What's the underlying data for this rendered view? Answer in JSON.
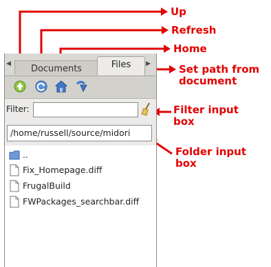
{
  "tabs": [
    {
      "label": "Documents",
      "active": false
    },
    {
      "label": "Files",
      "active": true
    }
  ],
  "toolbar": {
    "buttons": [
      {
        "name": "up-button",
        "icon": "arrow-up-icon"
      },
      {
        "name": "refresh-button",
        "icon": "refresh-icon"
      },
      {
        "name": "home-button",
        "icon": "home-icon"
      },
      {
        "name": "set-path-button",
        "icon": "set-path-icon"
      }
    ]
  },
  "filter": {
    "label": "Filter:",
    "value": "",
    "clear_icon": "broom-icon"
  },
  "folder": {
    "value": "/home/russell/source/midori"
  },
  "files": [
    {
      "name": "..",
      "type": "folder"
    },
    {
      "name": "Fix_Homepage.diff",
      "type": "file"
    },
    {
      "name": "FrugalBuild",
      "type": "file"
    },
    {
      "name": "FWPackages_searchbar.diff",
      "type": "file"
    }
  ],
  "annotations": {
    "up": "Up",
    "refresh": "Refresh",
    "home": "Home",
    "set_path_1": "Set path from",
    "set_path_2": "document",
    "filter_1": "Filter input",
    "filter_2": "box",
    "folder_1": "Folder input",
    "folder_2": "box"
  },
  "colors": {
    "annotation": "#e30000",
    "up_icon": "#7bbf2f",
    "blue_icon": "#3b6fb6"
  }
}
